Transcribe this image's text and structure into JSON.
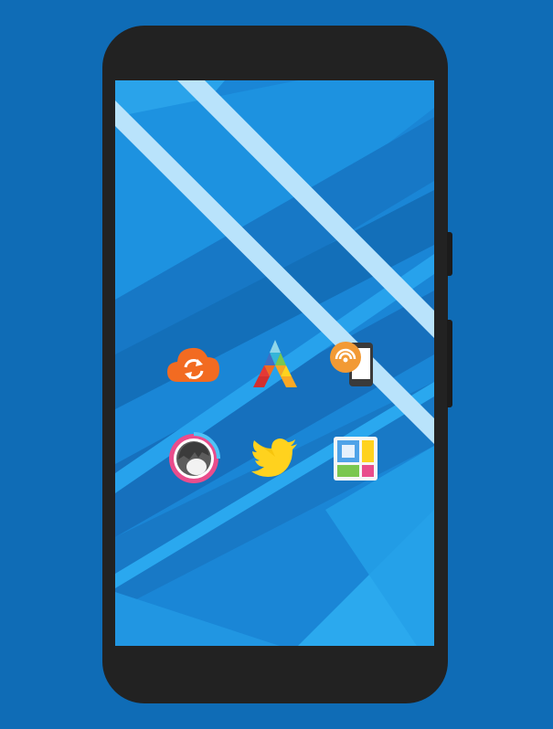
{
  "colors": {
    "background": "#0f6cb6",
    "phone_body": "#222222",
    "wallpaper_base": "#1a86d6",
    "wallpaper_light_stripe": "#b9e3fb"
  },
  "home_screen": {
    "icons": [
      {
        "name": "cloud-sync-icon",
        "color": "#f26b21"
      },
      {
        "name": "triangle-a-icon",
        "color": "#35b5d9"
      },
      {
        "name": "phone-hotspot-icon",
        "color": "#f29a35"
      },
      {
        "name": "avatar-ring-icon",
        "color": "#e94d8c"
      },
      {
        "name": "twitter-bird-icon",
        "color": "#ffd21e"
      },
      {
        "name": "photo-collage-icon",
        "color": "#f6f6f6"
      }
    ]
  }
}
